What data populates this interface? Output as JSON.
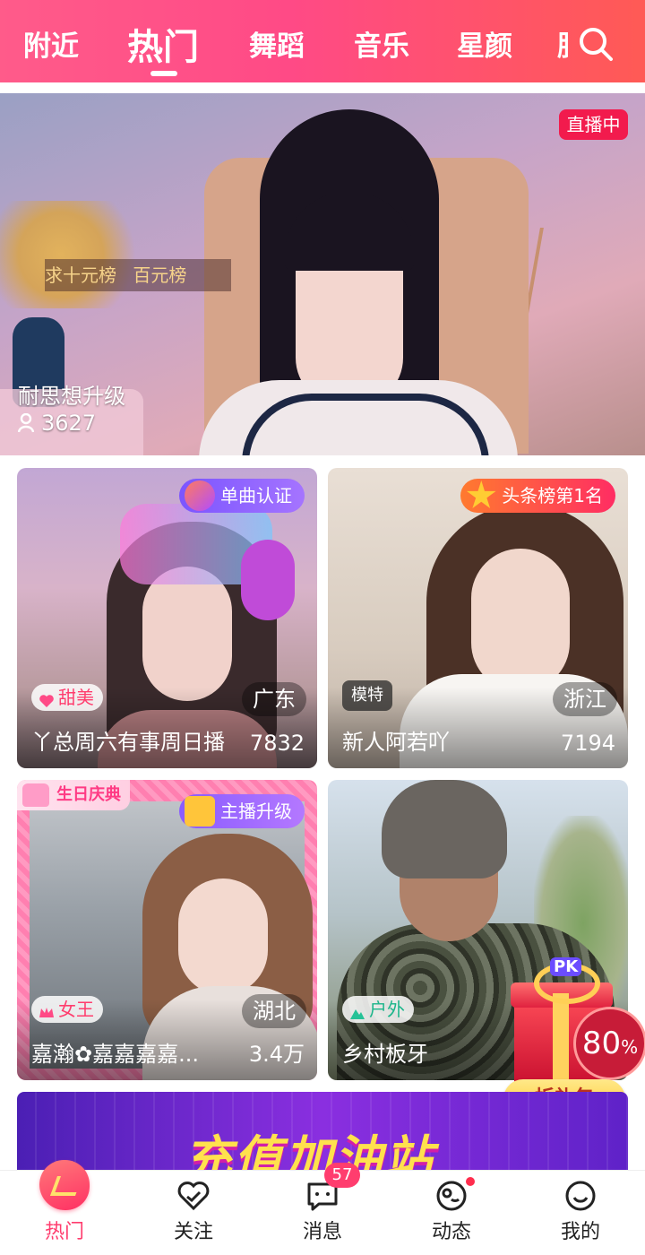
{
  "top_tabs": [
    {
      "label": "附近",
      "active": false
    },
    {
      "label": "热门",
      "active": true
    },
    {
      "label": "舞蹈",
      "active": false
    },
    {
      "label": "音乐",
      "active": false
    },
    {
      "label": "星颜",
      "active": false
    }
  ],
  "top_tab_partial": "脱",
  "feature": {
    "live_badge": "直播中",
    "rank_text_1": "求十元榜",
    "rank_text_2": "百元榜",
    "streamer": "耐思想升级",
    "viewers": "3627"
  },
  "cards": [
    {
      "badge": "单曲认证",
      "tag": "甜美",
      "region": "广东",
      "name": "丫总周六有事周日播",
      "count": "7832"
    },
    {
      "badge": "头条榜第1名",
      "tag": "模特",
      "region": "浙江",
      "name": "新人阿若吖",
      "count": "7194"
    },
    {
      "corner": "生日庆典",
      "badge": "主播升级",
      "tag": "女王",
      "region": "湖北",
      "name": "嘉瀚✿嘉嘉嘉嘉...",
      "count": "3.4万"
    },
    {
      "tag": "户外",
      "name": "乡村板牙",
      "count": ""
    }
  ],
  "gift": {
    "pk": "PK",
    "percent": "80",
    "percent_unit": "%",
    "button": "拆礼包"
  },
  "banner": {
    "title": "充值加油站"
  },
  "bottom_nav": [
    {
      "label": "热门",
      "active": true
    },
    {
      "label": "关注",
      "active": false
    },
    {
      "label": "消息",
      "active": false,
      "badge": "57"
    },
    {
      "label": "动态",
      "active": false
    },
    {
      "label": "我的",
      "active": false
    }
  ]
}
